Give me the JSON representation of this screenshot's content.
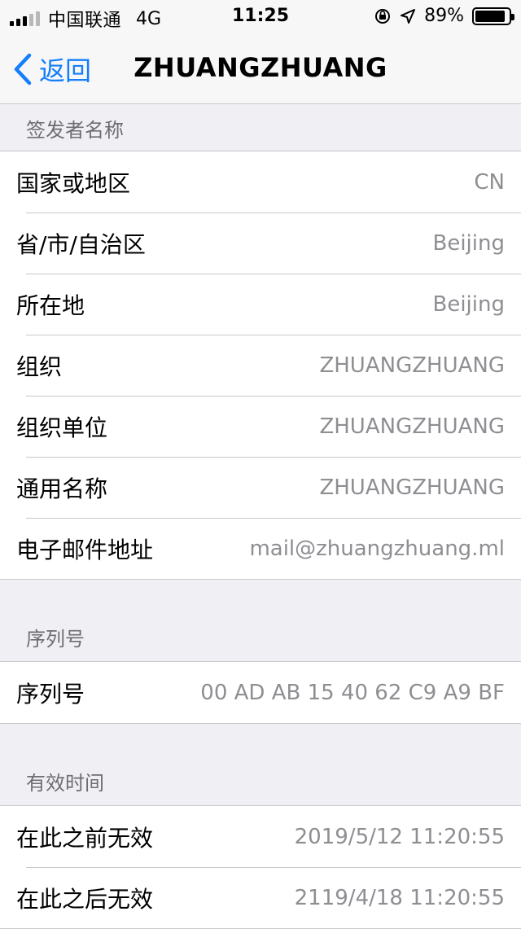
{
  "status_bar": {
    "carrier": "中国联通",
    "network": "4G",
    "time": "11:25",
    "battery": "89%",
    "battery_level": 0.89
  },
  "nav": {
    "back_label": "返回",
    "title": "ZHUANGZHUANG"
  },
  "issuer": {
    "header": "签发者名称",
    "rows": [
      {
        "label": "国家或地区",
        "value": "CN"
      },
      {
        "label": "省/市/自治区",
        "value": "Beijing"
      },
      {
        "label": "所在地",
        "value": "Beijing"
      },
      {
        "label": "组织",
        "value": "ZHUANGZHUANG"
      },
      {
        "label": "组织单位",
        "value": "ZHUANGZHUANG"
      },
      {
        "label": "通用名称",
        "value": "ZHUANGZHUANG"
      },
      {
        "label": "电子邮件地址",
        "value": "mail@zhuangzhuang.ml"
      }
    ]
  },
  "serial": {
    "header": "序列号",
    "rows": [
      {
        "label": "序列号",
        "value": "00 AD AB 15 40 62 C9 A9 BF"
      }
    ]
  },
  "validity": {
    "header": "有效时间",
    "rows": [
      {
        "label": "在此之前无效",
        "value": "2019/5/12 11:20:55"
      },
      {
        "label": "在此之后无效",
        "value": "2119/4/18 11:20:55"
      }
    ]
  },
  "colors": {
    "accent": "#157efb",
    "secondary_text": "#8e8e93",
    "section_header": "#6d6d72",
    "background": "#efeff4"
  }
}
